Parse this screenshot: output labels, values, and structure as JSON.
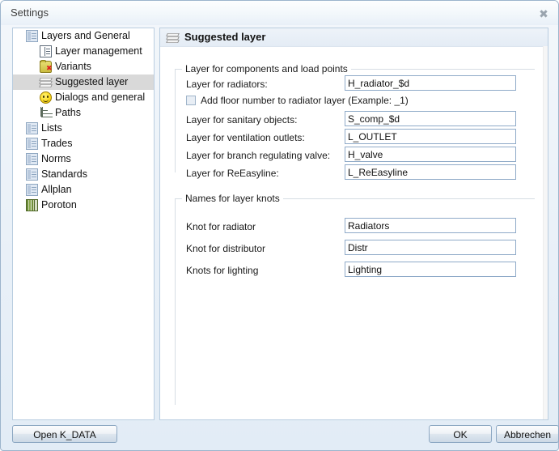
{
  "window": {
    "title": "Settings",
    "close_icon": "close-icon",
    "close_glyph": "✖"
  },
  "sidebar": {
    "items": [
      {
        "label": "Layers and General",
        "icon": "window-icon",
        "level": 0,
        "selected": false
      },
      {
        "label": "Layer management",
        "icon": "form-icon",
        "level": 1,
        "selected": false
      },
      {
        "label": "Variants",
        "icon": "folder-delete-icon",
        "level": 1,
        "selected": false
      },
      {
        "label": "Suggested layer",
        "icon": "layers-icon",
        "level": 1,
        "selected": true
      },
      {
        "label": "Dialogs and general",
        "icon": "smiley-icon",
        "level": 1,
        "selected": false
      },
      {
        "label": "Paths",
        "icon": "paths-tree-icon",
        "level": 1,
        "selected": false
      },
      {
        "label": "Lists",
        "icon": "window-icon",
        "level": 0,
        "selected": false
      },
      {
        "label": "Trades",
        "icon": "window-icon",
        "level": 0,
        "selected": false
      },
      {
        "label": "Norms",
        "icon": "window-icon",
        "level": 0,
        "selected": false
      },
      {
        "label": "Standards",
        "icon": "window-icon",
        "level": 0,
        "selected": false
      },
      {
        "label": "Allplan",
        "icon": "window-icon",
        "level": 0,
        "selected": false
      },
      {
        "label": "Poroton",
        "icon": "book-icon",
        "level": 0,
        "selected": false
      }
    ]
  },
  "panel": {
    "header_title": "Suggested layer",
    "header_icon": "layers-icon",
    "group_components": {
      "title": "Layer for components and load points",
      "fields": [
        {
          "label": "Layer for radiators:",
          "value": "H_radiator_$d"
        },
        {
          "label": "Layer for sanitary objects:",
          "value": "S_comp_$d"
        },
        {
          "label": "Layer for ventilation outlets:",
          "value": "L_OUTLET"
        },
        {
          "label": "Layer for branch regulating valve:",
          "value": "H_valve"
        },
        {
          "label": "Layer for ReEasyline:",
          "value": "L_ReEasyline"
        }
      ],
      "checkbox": {
        "label": "Add floor number to radiator layer (Example: _1)",
        "checked": false
      }
    },
    "group_knots": {
      "title": "Names for layer knots",
      "fields": [
        {
          "label": "Knot for radiator",
          "value": "Radiators"
        },
        {
          "label": "Knot for distributor",
          "value": "Distr"
        },
        {
          "label": "Knots for lighting",
          "value": "Lighting"
        }
      ]
    }
  },
  "footer": {
    "open_label": "Open K_DATA",
    "ok_label": "OK",
    "cancel_label": "Abbrechen"
  },
  "colors": {
    "window_border": "#9cb4cc",
    "panel_border": "#b9cde0",
    "input_border": "#8faac8",
    "selection": "#d9d9d9",
    "header_gradient_top": "#eef3f9",
    "text": "#1a1a1a"
  }
}
